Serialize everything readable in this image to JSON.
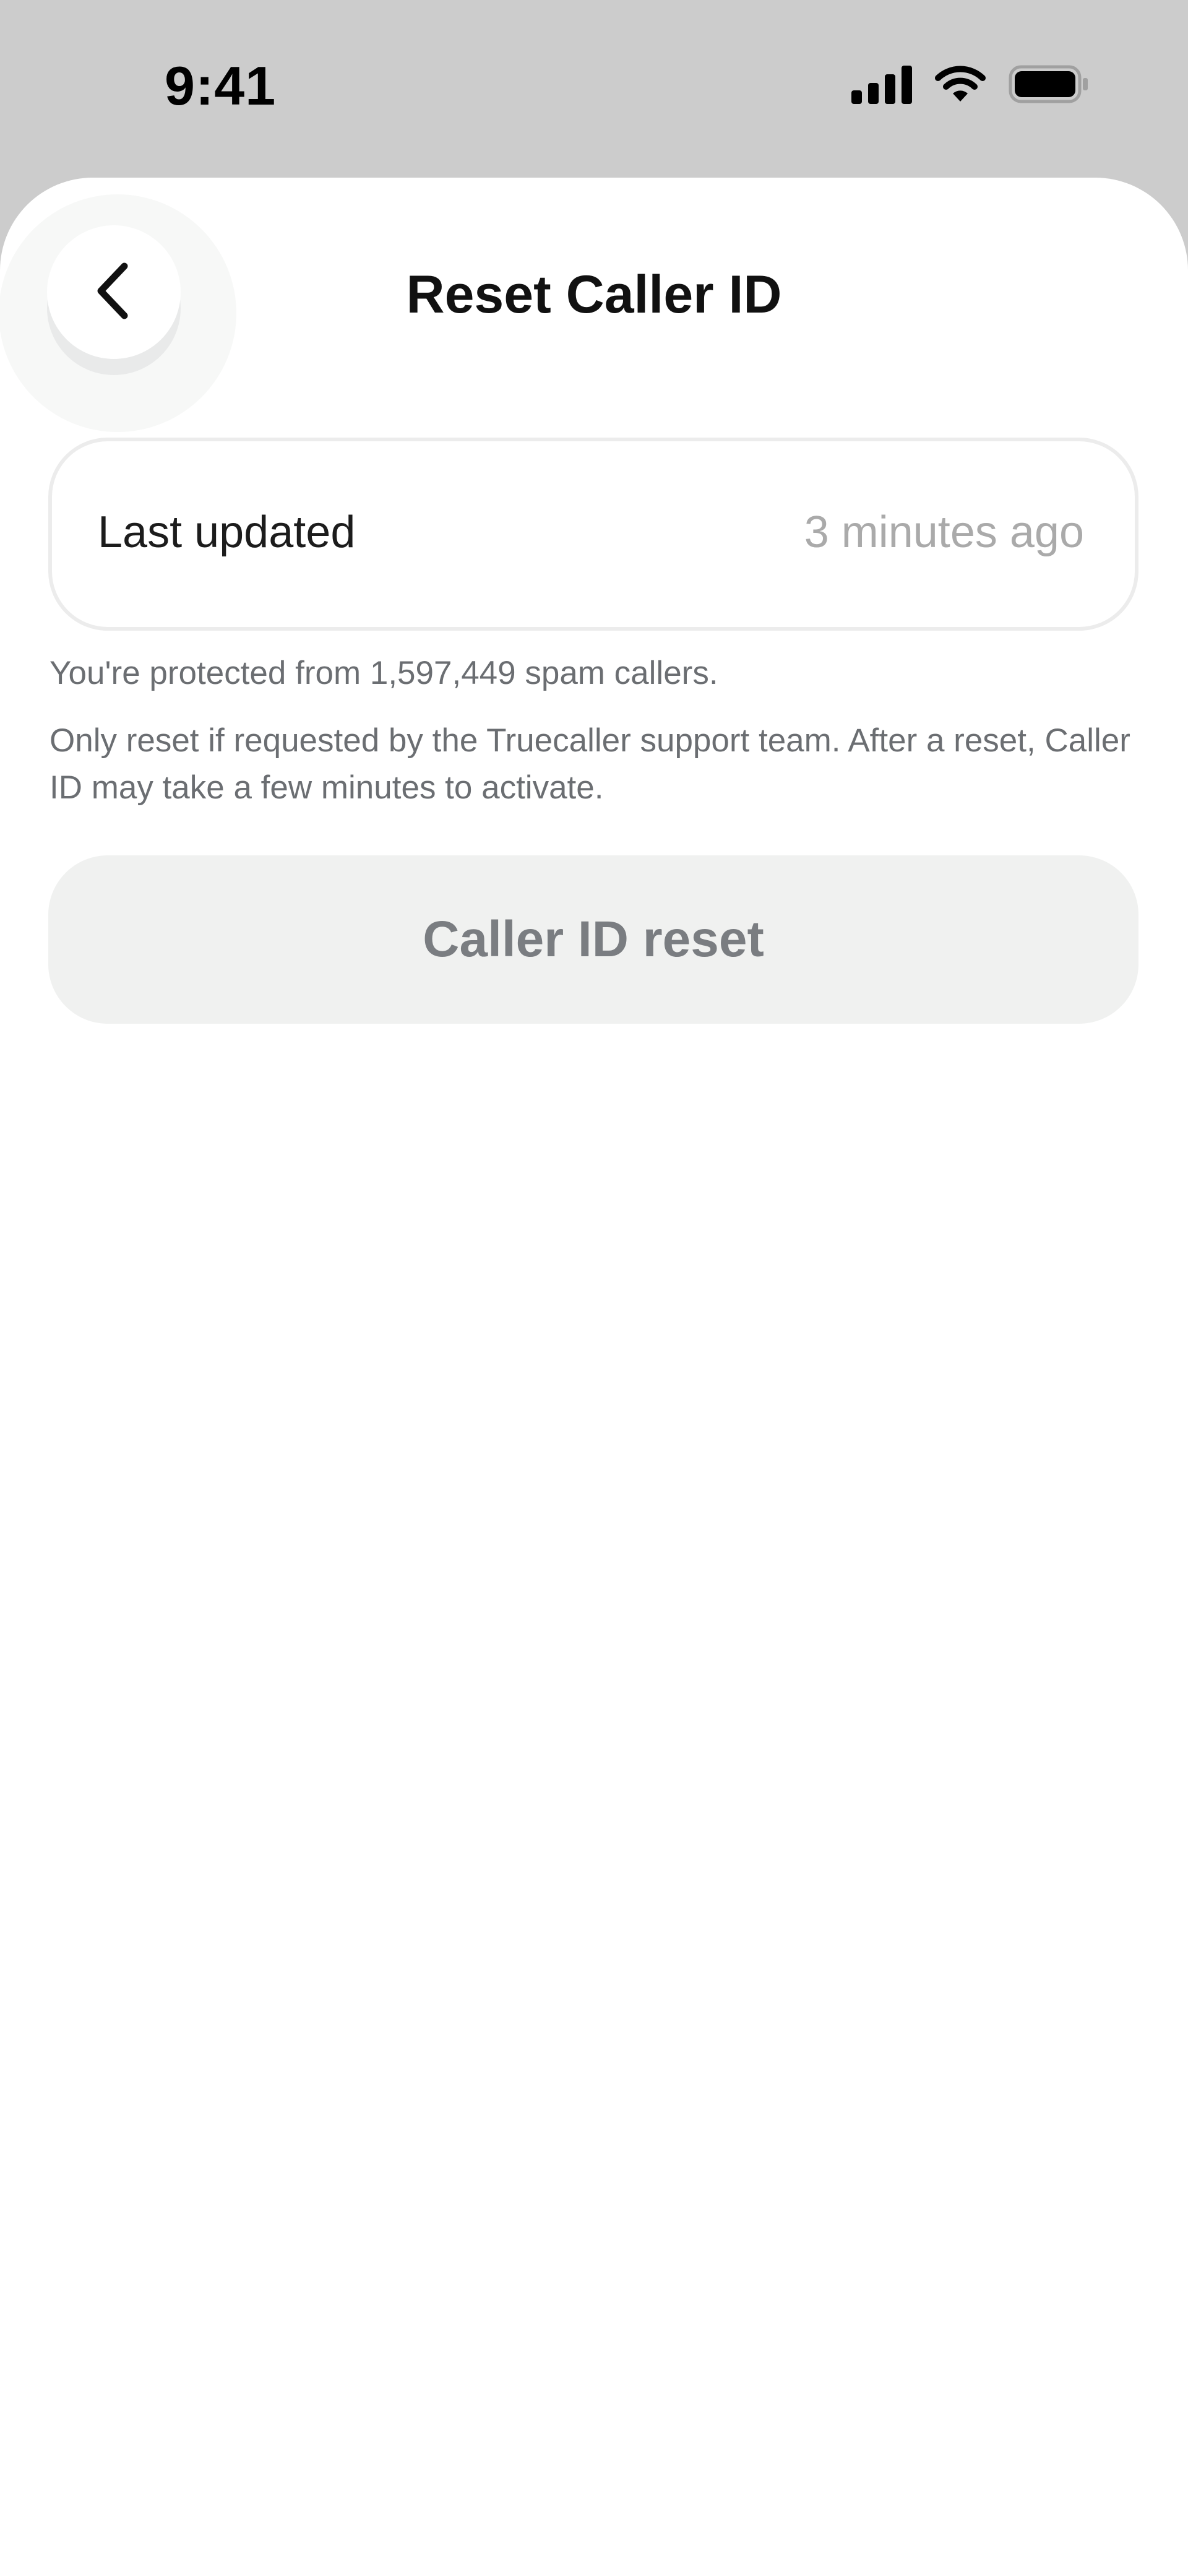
{
  "status_bar": {
    "time": "9:41"
  },
  "header": {
    "title": "Reset Caller ID",
    "back_icon": "chevron-left-icon"
  },
  "info_card": {
    "label": "Last updated",
    "value": "3 minutes ago"
  },
  "protection_text": "You're protected from 1,597,449 spam callers.",
  "description": "Only reset if requested by the Truecaller support team. After a reset, Caller ID may take a few minutes to activate.",
  "reset_button": {
    "label": "Caller ID reset"
  },
  "colors": {
    "status_bar_bg": "#cccccc",
    "sheet_bg": "#ffffff",
    "button_bg": "#f0f1f0",
    "button_text": "#7a7d81",
    "secondary_text": "#6b6e72",
    "muted_value": "#aaaaaa"
  }
}
